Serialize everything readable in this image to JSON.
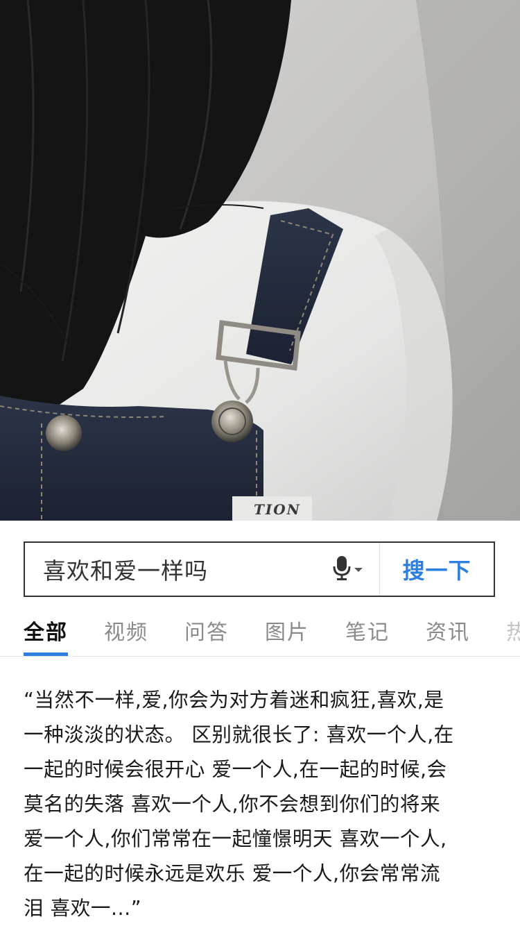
{
  "search": {
    "query": "喜欢和爱一样吗",
    "button_label": "搜一下"
  },
  "tabs": [
    {
      "label": "全部",
      "active": true
    },
    {
      "label": "视频",
      "active": false
    },
    {
      "label": "问答",
      "active": false
    },
    {
      "label": "图片",
      "active": false
    },
    {
      "label": "笔记",
      "active": false
    },
    {
      "label": "资讯",
      "active": false
    },
    {
      "label": "热",
      "active": false
    }
  ],
  "answer": {
    "lines": [
      "“当然不一样,爱,你会为对方着迷和疯狂,喜欢,是",
      "一种淡淡的状态。 区别就很长了: 喜欢一个人,在",
      "一起的时候会很开心 爱一个人,在一起的时候,会",
      "莫名的失落 喜欢一个人,你不会想到你们的将来",
      "爱一个人,你们常常在一起憧憬明天 喜欢一个人,",
      "在一起的时候永远是欢乐 爱一个人,你会常常流",
      "泪 喜欢一...”"
    ]
  },
  "photo": {
    "label_text": "TION"
  },
  "colors": {
    "accent": "#2f7fdd",
    "border": "#333333",
    "tab_inactive": "#8a8a8a"
  },
  "icons": {
    "mic": "microphone-icon",
    "dropdown": "caret-down-icon"
  }
}
